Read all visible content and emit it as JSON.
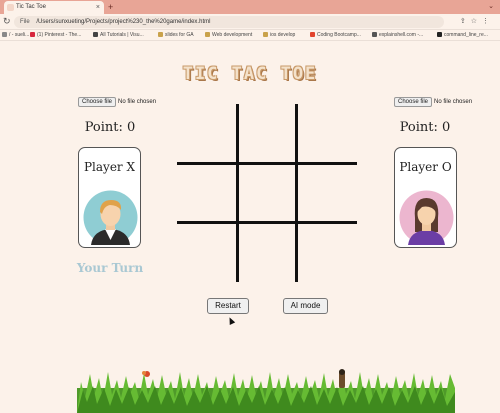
{
  "browser": {
    "tab_title": "Tic Tac Toe",
    "tab_close": "×",
    "new_tab": "+",
    "tab_menu": "⌄",
    "url_label": "File",
    "url": "/Users/sunxueting/Projects/project%230_the%20game/index.html",
    "bookmarks": [
      "/ - sueli...",
      "(1) Pinterest - The...",
      "All Tutorials | Visu...",
      "slides for GA",
      "Web development",
      "ios develop",
      "Coding Bootcamp...",
      "explainshell.com -...",
      "command_line_re..."
    ],
    "bookmark_colors": [
      "#888888",
      "#d7263d",
      "#444444",
      "#c9a24b",
      "#c9a24b",
      "#c9a24b",
      "#e2432c",
      "#555555",
      "#222222"
    ]
  },
  "game": {
    "title": "TIC TAC TOE",
    "left_file": {
      "button": "Choose file",
      "status": "No file chosen"
    },
    "right_file": {
      "button": "Choose file",
      "status": "No file chosen"
    },
    "player_x": {
      "points": "Point: 0",
      "name": "Player X",
      "avatar_icon": "man-avatar-icon"
    },
    "player_o": {
      "points": "Point: 0",
      "name": "Player O",
      "avatar_icon": "woman-avatar-icon"
    },
    "turn_text": "Your Turn",
    "board": [
      "",
      "",
      "",
      "",
      "",
      "",
      "",
      "",
      ""
    ],
    "restart_label": "Restart",
    "ai_label": "AI mode",
    "colors": {
      "background": "#fcf2ea",
      "turn": "#a9c8d3",
      "grid": "#111111",
      "title_shadow": "#c89a6a"
    }
  }
}
